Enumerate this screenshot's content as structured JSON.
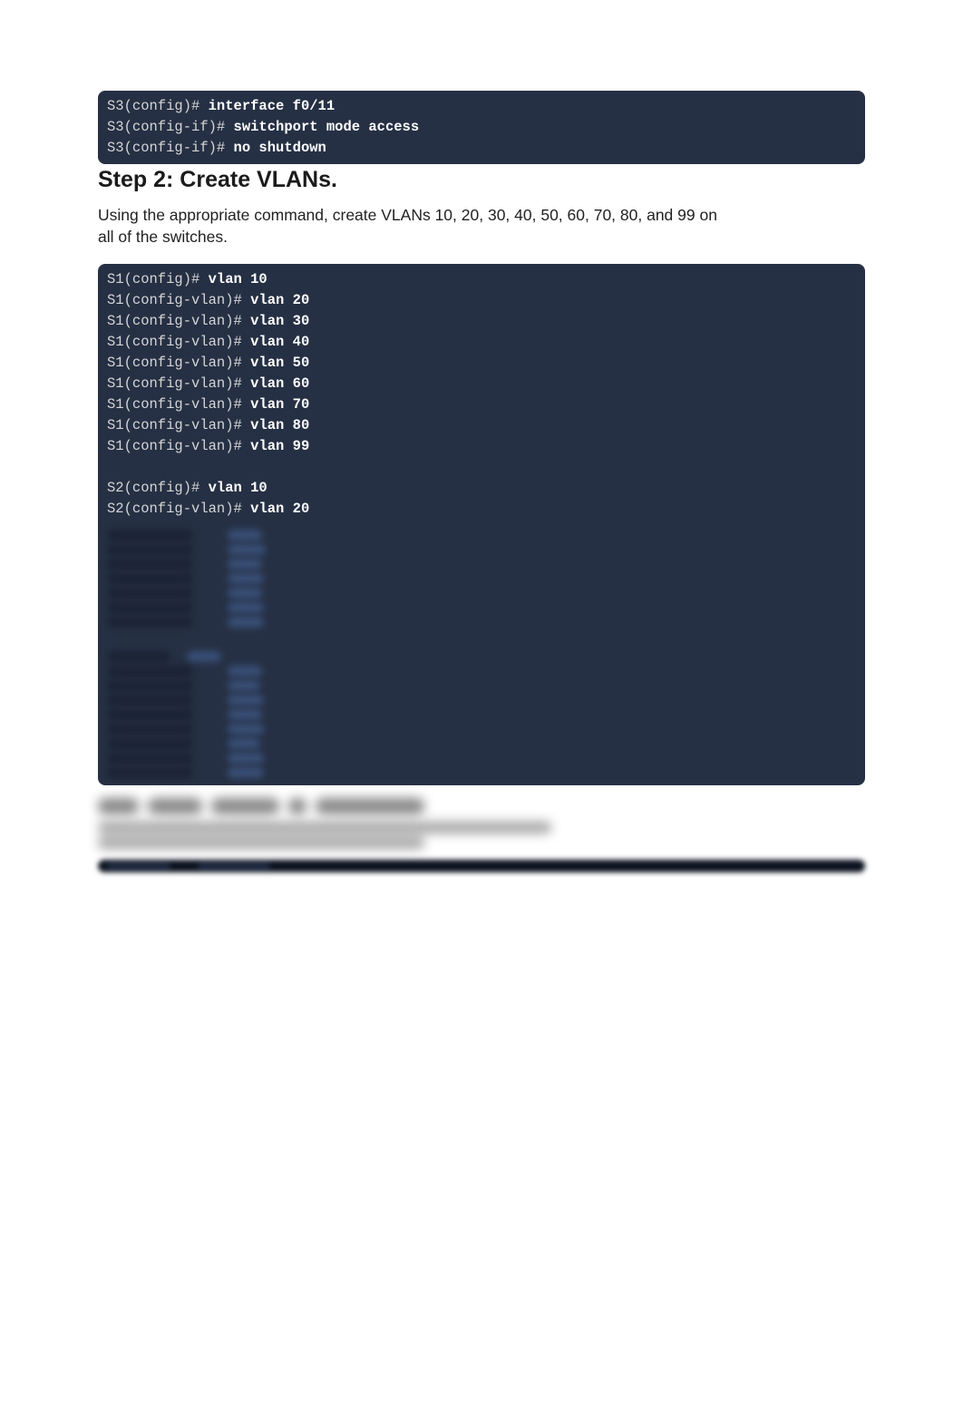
{
  "block1": {
    "lines": [
      {
        "prompt": "S3(config)#",
        "cmd": "interface f0/11"
      },
      {
        "prompt": "S3(config-if)#",
        "cmd": "switchport mode access"
      },
      {
        "prompt": "S3(config-if)#",
        "cmd": "no shutdown"
      }
    ]
  },
  "step2": {
    "title": "Step 2: Create VLANs.",
    "body": "Using the appropriate command, create VLANs 10, 20, 30, 40, 50, 60, 70, 80, and 99 on all of the switches."
  },
  "block2": {
    "s1": [
      {
        "prompt": "S1(config)#",
        "cmd": "vlan 10"
      },
      {
        "prompt": "S1(config-vlan)#",
        "cmd": "vlan 20"
      },
      {
        "prompt": "S1(config-vlan)#",
        "cmd": "vlan 30"
      },
      {
        "prompt": "S1(config-vlan)#",
        "cmd": "vlan 40"
      },
      {
        "prompt": "S1(config-vlan)#",
        "cmd": "vlan 50"
      },
      {
        "prompt": "S1(config-vlan)#",
        "cmd": "vlan 60"
      },
      {
        "prompt": "S1(config-vlan)#",
        "cmd": "vlan 70"
      },
      {
        "prompt": "S1(config-vlan)#",
        "cmd": "vlan 80"
      },
      {
        "prompt": "S1(config-vlan)#",
        "cmd": "vlan 99"
      }
    ],
    "s2": [
      {
        "prompt": "S2(config)#",
        "cmd": "vlan 10"
      },
      {
        "prompt": "S2(config-vlan)#",
        "cmd": "vlan 20"
      }
    ]
  },
  "obscured_note": "Remaining S2 and S3 vlan commands plus Step 3 heading/body and next code bar are blurred/unreadable in the source image."
}
